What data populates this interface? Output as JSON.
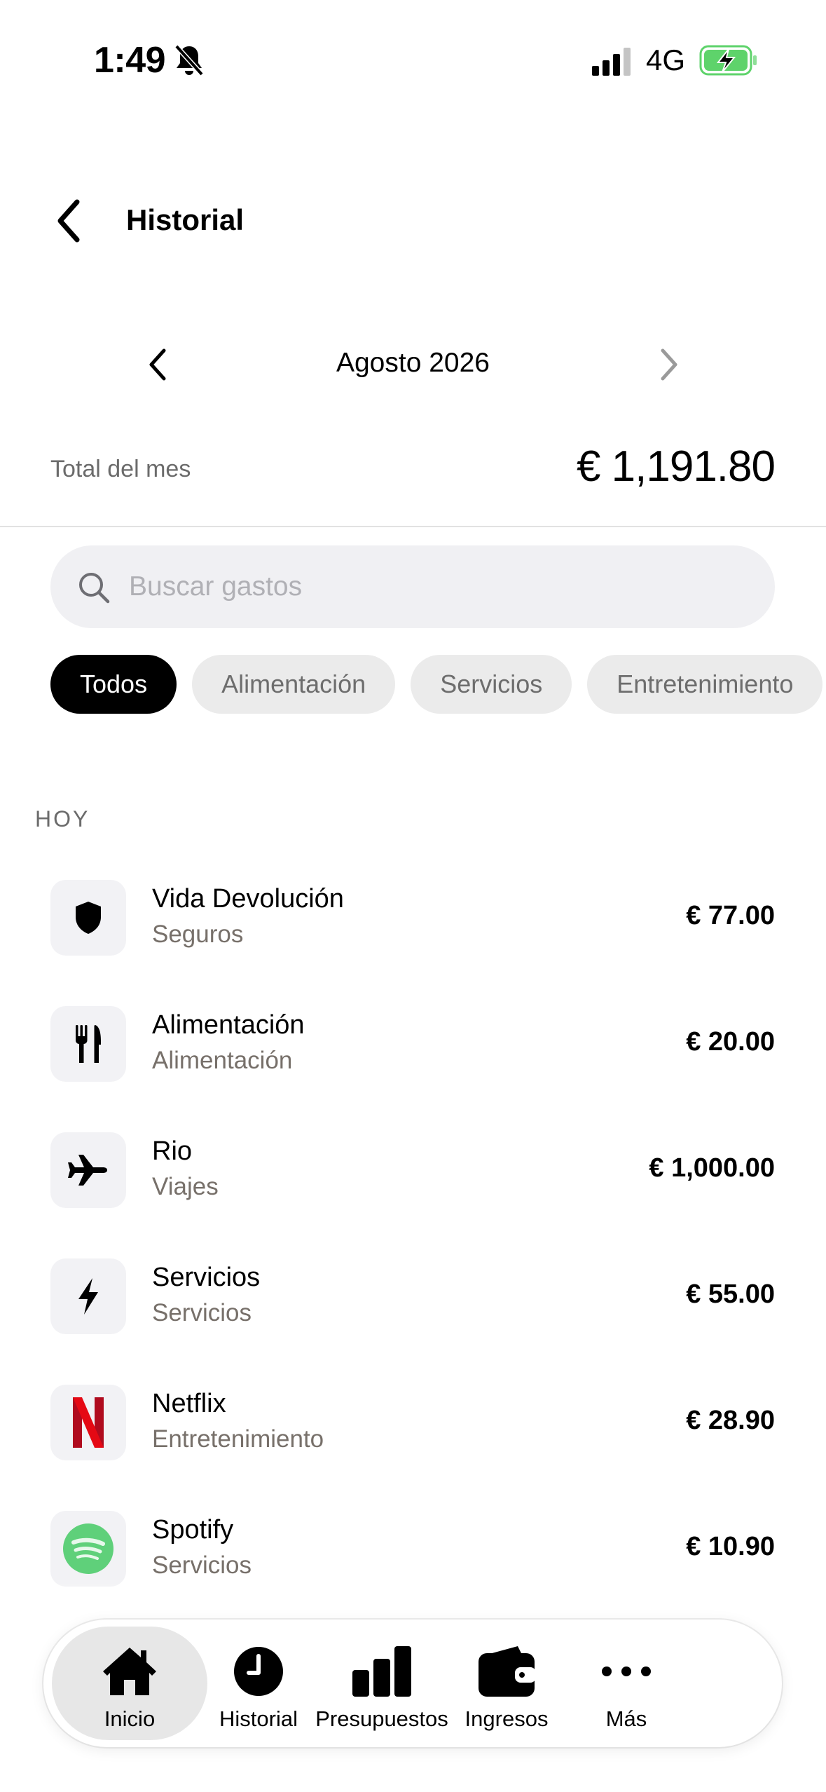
{
  "status_bar": {
    "time": "1:49",
    "network": "4G"
  },
  "header": {
    "title": "Historial"
  },
  "month_nav": {
    "label": "Agosto 2026"
  },
  "total": {
    "label": "Total del mes",
    "value": "€ 1,191.80"
  },
  "search": {
    "placeholder": "Buscar gastos",
    "value": ""
  },
  "chips": [
    "Todos",
    "Alimentación",
    "Servicios",
    "Entretenimiento"
  ],
  "section": {
    "label": "HOY"
  },
  "expenses": [
    {
      "name": "Vida Devolución",
      "category": "Seguros",
      "amount": "€ 77.00",
      "icon": "shield-icon"
    },
    {
      "name": "Alimentación",
      "category": "Alimentación",
      "amount": "€ 20.00",
      "icon": "utensils-icon"
    },
    {
      "name": "Rio",
      "category": "Viajes",
      "amount": "€ 1,000.00",
      "icon": "airplane-icon"
    },
    {
      "name": "Servicios",
      "category": "Servicios",
      "amount": "€ 55.00",
      "icon": "lightning-icon"
    },
    {
      "name": "Netflix",
      "category": "Entretenimiento",
      "amount": "€ 28.90",
      "icon": "netflix-logo-icon"
    },
    {
      "name": "Spotify",
      "category": "Servicios",
      "amount": "€ 10.90",
      "icon": "spotify-logo-icon"
    }
  ],
  "tabs": [
    {
      "label": "Inicio",
      "icon": "home-icon"
    },
    {
      "label": "Historial",
      "icon": "clock-icon"
    },
    {
      "label": "Presupuestos",
      "icon": "bar-chart-icon"
    },
    {
      "label": "Ingresos",
      "icon": "wallet-icon"
    },
    {
      "label": "Más",
      "icon": "more-icon"
    }
  ],
  "colors": {
    "active_chip": "#000000",
    "chip_bg": "#ebebeb",
    "netflix_red": "#c8102e",
    "spotify_green": "#5fd07a",
    "battery_green": "#5ed36b"
  }
}
